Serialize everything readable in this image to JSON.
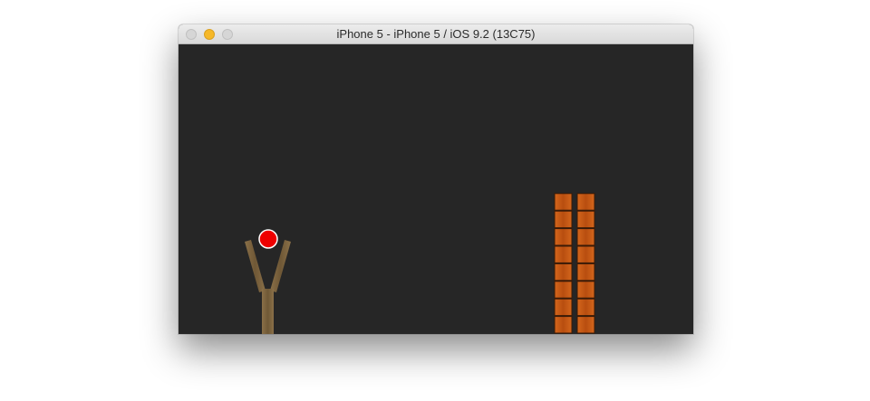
{
  "window": {
    "title": "iPhone 5 - iPhone 5 / iOS 9.2 (13C75)",
    "controls": [
      "close",
      "minimize",
      "zoom"
    ]
  },
  "game": {
    "background_color": "#262626",
    "slingshot": {
      "color": "#7d6440",
      "icon": "slingshot"
    },
    "projectile": {
      "color": "#ee0000",
      "icon": "red-ball"
    },
    "towers": [
      {
        "blocks": 8,
        "color": "#c85a14"
      },
      {
        "blocks": 8,
        "color": "#c85a14"
      }
    ]
  }
}
